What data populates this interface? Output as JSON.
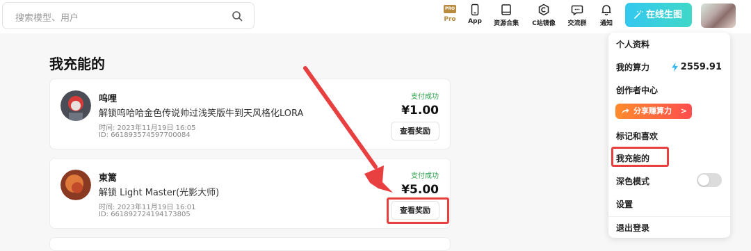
{
  "search": {
    "placeholder": "搜索模型、用户"
  },
  "nav": [
    {
      "label": "Pro",
      "badge": "PRO",
      "icon": "pro-icon"
    },
    {
      "label": "App",
      "icon": "phone-icon"
    },
    {
      "label": "资源合集",
      "icon": "book-icon"
    },
    {
      "label": "C站镜像",
      "icon": "c-logo-icon"
    },
    {
      "label": "交流群",
      "icon": "chat-icon"
    },
    {
      "label": "通知",
      "icon": "bell-icon"
    }
  ],
  "generate_button": {
    "label": "在线生图",
    "icon": "wand-icon"
  },
  "page": {
    "title": "我充能的"
  },
  "records": [
    {
      "name": "呜哩",
      "description": "解锁呜哈哈金色传说帅过浅笑版牛到天风格化LORA",
      "time": "时间: 2023年11月19日 16:05",
      "id": "ID: 661893574597700084",
      "status": "支付成功",
      "amount": "¥1.00",
      "button": "查看奖励"
    },
    {
      "name": "東篱",
      "description": "解锁 Light Master(光影大师)",
      "time": "时间: 2023年11月19日 16:01",
      "id": "ID: 661892724194173805",
      "status": "支付成功",
      "amount": "¥5.00",
      "button": "查看奖励"
    }
  ],
  "menu": {
    "profile": "个人资料",
    "compute": "我的算力",
    "compute_value": "2559.91",
    "creator": "创作者中心",
    "share": "分享赚算力",
    "share_chevron": ">",
    "favorites": "标记和喜欢",
    "charged": "我充能的",
    "dark_mode": "深色模式",
    "dark_mode_on": false,
    "settings": "设置",
    "logout": "退出登录"
  },
  "colors": {
    "accent": "#34c8f0",
    "success": "#2aa04a",
    "annotation": "#e84040",
    "pro": "#b88a3e"
  }
}
